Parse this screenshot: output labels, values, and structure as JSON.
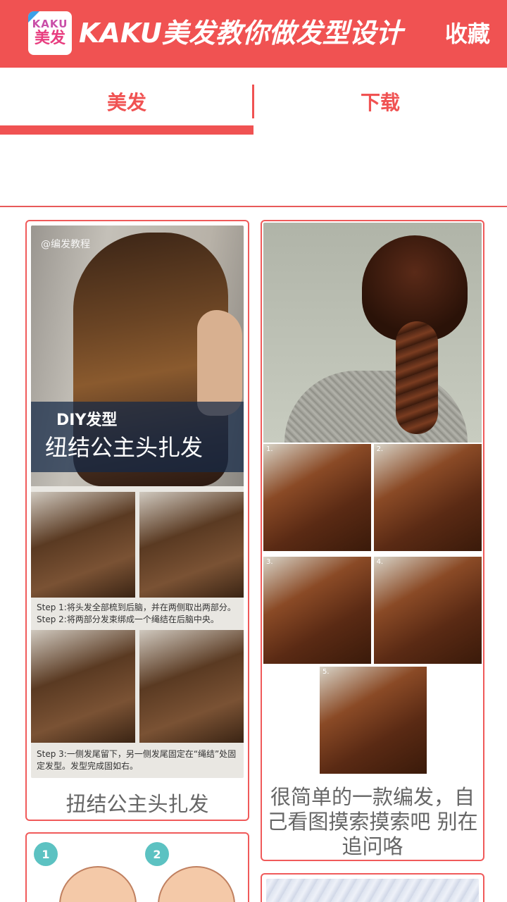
{
  "header": {
    "icon_text_top": "KAKU",
    "icon_text_bottom": "美发",
    "title": "KAKU美发教你做发型设计",
    "collect_label": "收藏"
  },
  "tabs": [
    {
      "label": "美发",
      "active": true
    },
    {
      "label": "下载",
      "active": false
    }
  ],
  "colors": {
    "accent": "#f05252",
    "caption_text": "#666666",
    "badge": "#5cc2c2"
  },
  "cards": [
    {
      "caption": "扭结公主头扎发",
      "image": {
        "watermark": "@编发教程",
        "banner_small": "DIY发型",
        "banner_large": "纽结公主头扎发",
        "step1": "Step 1:将头发全部梳到后脑，并在两侧取出两部分。",
        "step2": "Step 2:将两部分发束绑成一个绳结在后脑中央。",
        "step3": "Step 3:一侧发尾留下，另一侧发尾固定在“绳结”处固定发型。发型完成固如右。"
      }
    },
    {
      "caption": "很简单的一款编发，自己看图摸索摸索吧 别在追问咯",
      "image": {
        "steps": [
          "1.",
          "2.",
          "3.",
          "4.",
          "5."
        ]
      }
    },
    {
      "caption": "",
      "image": {
        "badges": [
          "1",
          "2"
        ]
      }
    },
    {
      "caption": "",
      "image": {}
    }
  ]
}
